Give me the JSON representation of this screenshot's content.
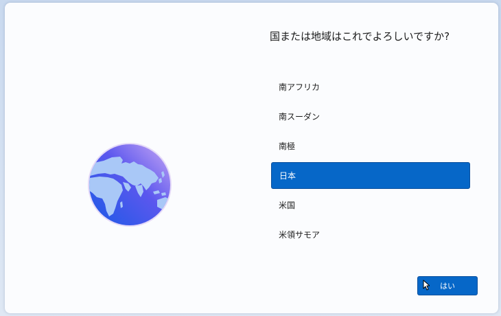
{
  "setup": {
    "question": "国または地域はこれでよろしいですか?",
    "countries": [
      {
        "label": "南アフリカ",
        "selected": false
      },
      {
        "label": "南スーダン",
        "selected": false
      },
      {
        "label": "南極",
        "selected": false
      },
      {
        "label": "日本",
        "selected": true
      },
      {
        "label": "米国",
        "selected": false
      },
      {
        "label": "米領サモア",
        "selected": false
      }
    ],
    "yes_button_label": "はい"
  },
  "icons": {
    "illustration": "globe-icon",
    "pointer": "mouse-cursor-icon"
  },
  "colors": {
    "accent": "#0667c8",
    "background": "#fbfcfe",
    "text": "#1a1a1a"
  }
}
